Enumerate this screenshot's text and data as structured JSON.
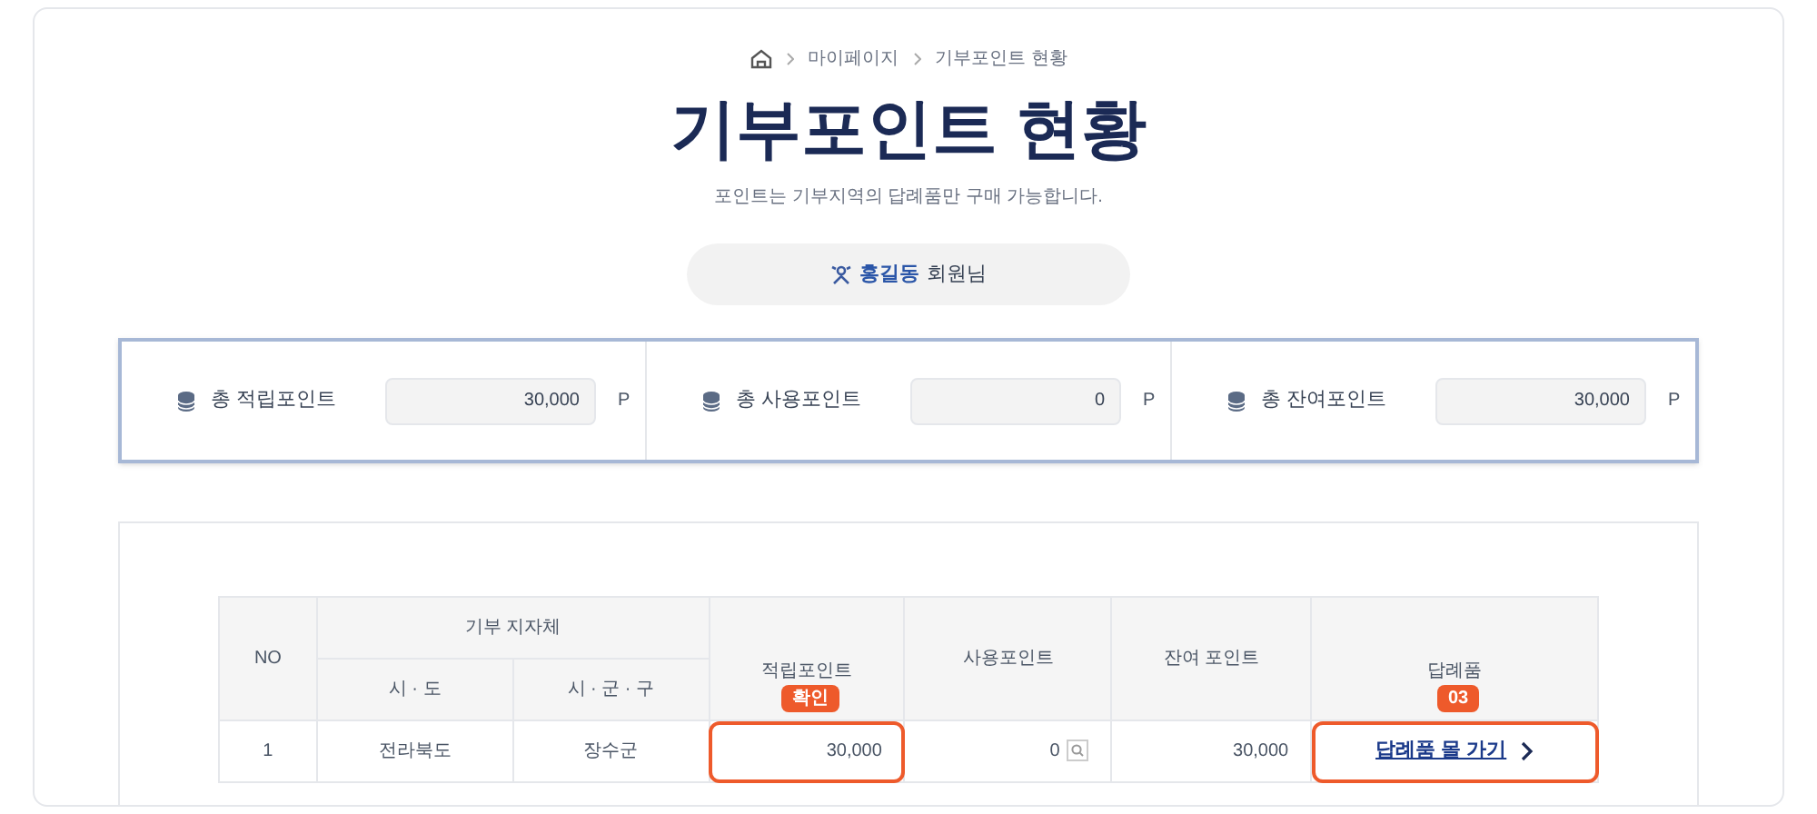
{
  "breadcrumb": [
    "마이페이지",
    "기부포인트 현황"
  ],
  "title": "기부포인트 현황",
  "subtitle": "포인트는 기부지역의 답례품만 구매 가능합니다.",
  "member": {
    "name": "홍길동",
    "suffix": "회원님"
  },
  "summary": [
    {
      "label": "총 적립포인트",
      "value": "30,000",
      "unit": "P"
    },
    {
      "label": "총 사용포인트",
      "value": "0",
      "unit": "P"
    },
    {
      "label": "총 잔여포인트",
      "value": "30,000",
      "unit": "P"
    }
  ],
  "table": {
    "columns": {
      "no": "NO",
      "group": "기부 지자체",
      "province": "시 · 도",
      "city": "시 · 군 · 구",
      "earned": "적립포인트",
      "used": "사용포인트",
      "remaining": "잔여 포인트",
      "gift": "답례품"
    },
    "rows": [
      {
        "no": "1",
        "province": "전라북도",
        "city": "장수군",
        "earned": "30,000",
        "used": "0",
        "remaining": "30,000",
        "gift_link": "답례품 몰 가기"
      }
    ]
  },
  "annotations": {
    "earned": "확인",
    "gift": "03"
  }
}
